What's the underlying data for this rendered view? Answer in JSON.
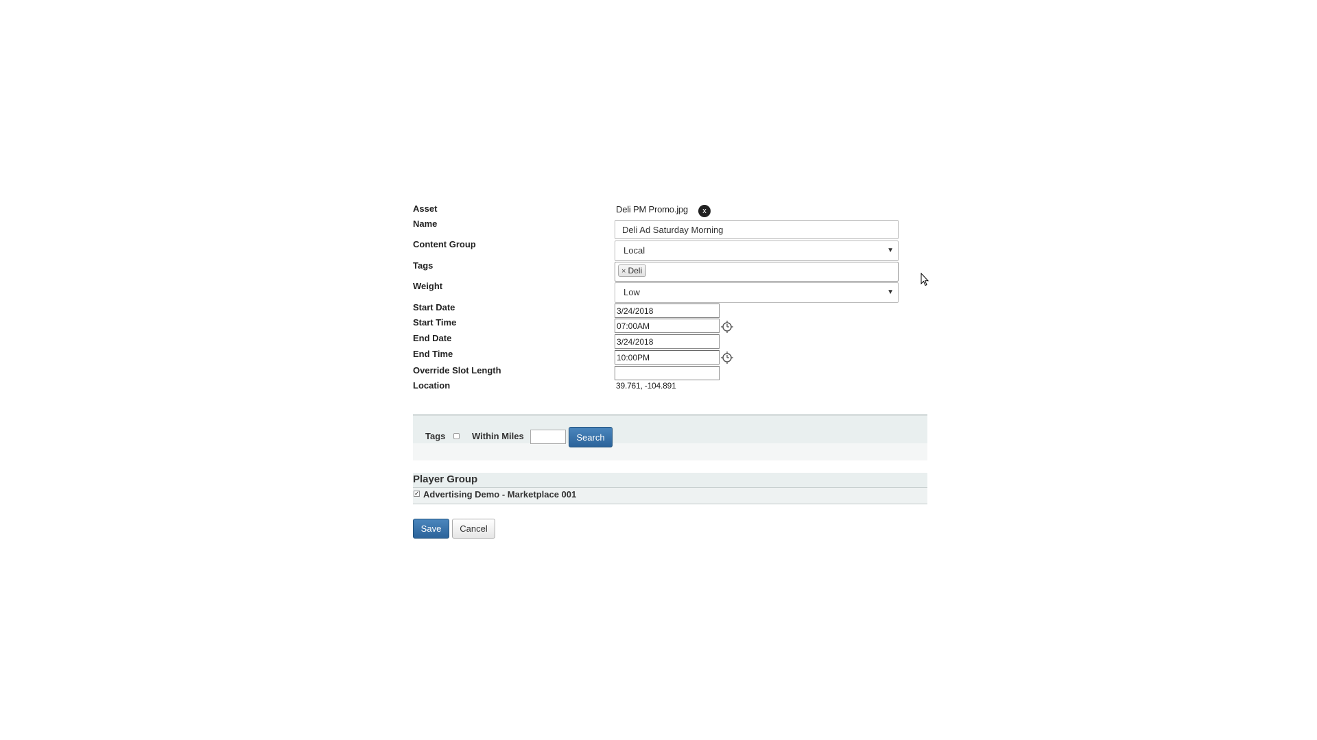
{
  "form": {
    "asset": {
      "label": "Asset",
      "value": "Deli PM Promo.jpg",
      "remove_symbol": "x"
    },
    "name": {
      "label": "Name",
      "value": "Deli Ad Saturday Morning"
    },
    "content_group": {
      "label": "Content Group",
      "selected": "Local"
    },
    "tags": {
      "label": "Tags",
      "chips": [
        {
          "label": "Deli",
          "remove_symbol": "×"
        }
      ]
    },
    "weight": {
      "label": "Weight",
      "selected": "Low"
    },
    "start_date": {
      "label": "Start Date",
      "value": "3/24/2018"
    },
    "start_time": {
      "label": "Start Time",
      "value": "07:00AM",
      "icon": "clock-icon"
    },
    "end_date": {
      "label": "End Date",
      "value": "3/24/2018"
    },
    "end_time": {
      "label": "End Time",
      "value": "10:00PM",
      "icon": "clock-icon"
    },
    "override_slot_length": {
      "label": "Override Slot Length",
      "value": ""
    },
    "location": {
      "label": "Location",
      "value": "39.761, -104.891"
    }
  },
  "search": {
    "tags_label": "Tags",
    "tags_checked": false,
    "within_miles_label": "Within Miles",
    "within_miles_value": "",
    "search_button": "Search"
  },
  "player_group": {
    "header": "Player Group",
    "items": [
      {
        "label": "Advertising Demo - Marketplace 001",
        "checked": true
      }
    ]
  },
  "actions": {
    "save": "Save",
    "cancel": "Cancel"
  },
  "colors": {
    "primary_button": "#2b639a",
    "panel_band": "#e9efef"
  }
}
